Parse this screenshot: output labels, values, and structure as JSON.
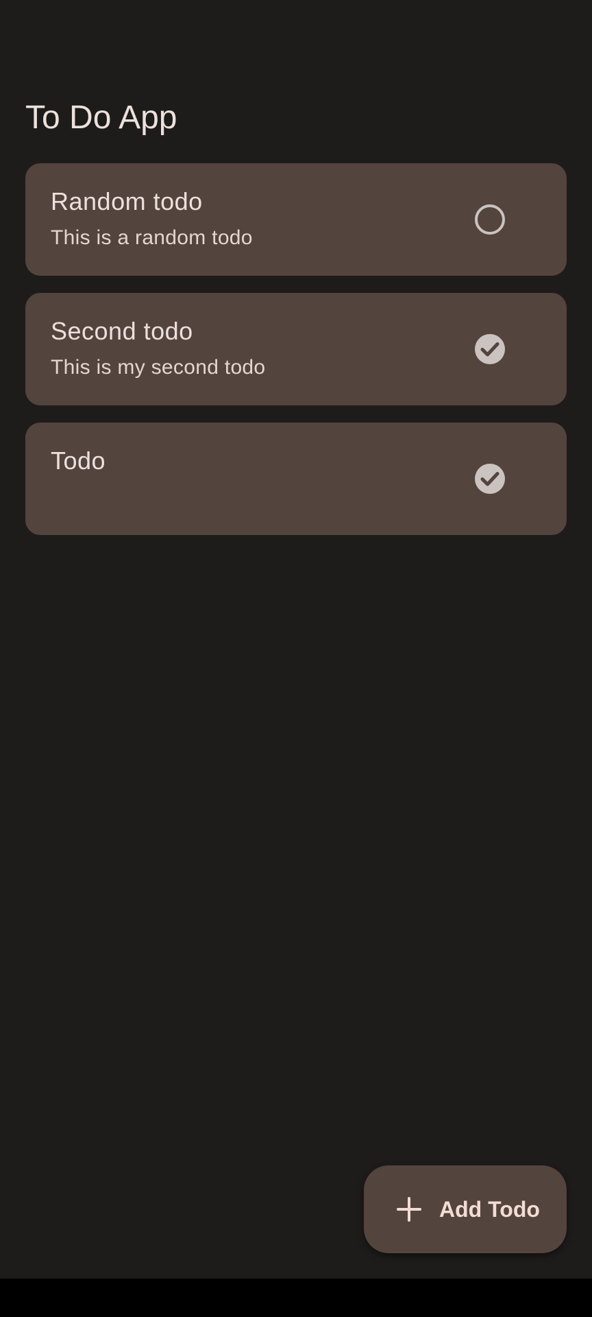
{
  "app": {
    "title": "To Do App"
  },
  "todos": [
    {
      "title": "Random todo",
      "description": "This is a random todo",
      "done": false
    },
    {
      "title": "Second todo",
      "description": "This is my second todo",
      "done": true
    },
    {
      "title": "Todo",
      "description": "",
      "done": true
    }
  ],
  "fab": {
    "label": "Add Todo",
    "icon": "plus-icon"
  },
  "colors": {
    "background": "#1e1c1b",
    "card": "#54443e",
    "text": "#ebe1dd",
    "checkbox": "#cbc3c0"
  }
}
